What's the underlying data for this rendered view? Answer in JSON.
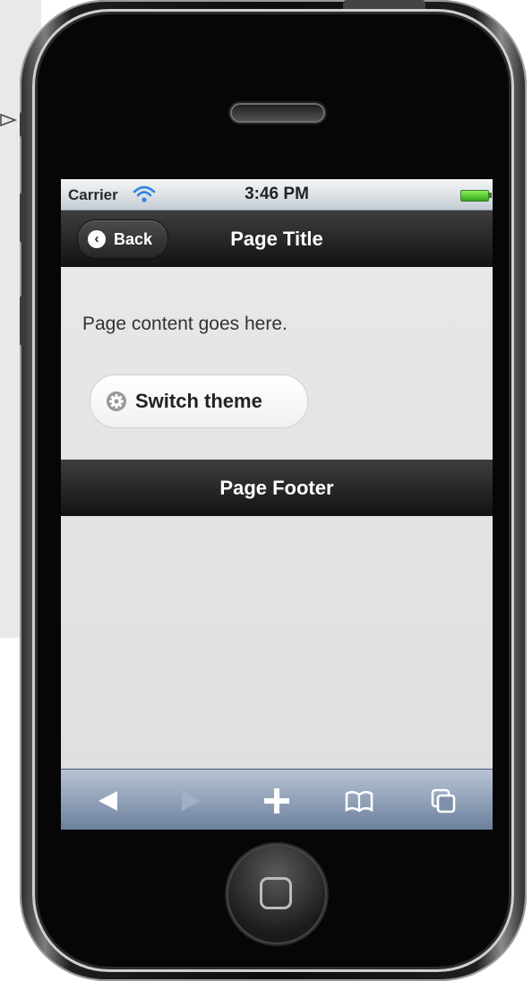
{
  "status_bar": {
    "carrier": "Carrier",
    "time": "3:46 PM"
  },
  "header": {
    "back_label": "Back",
    "title": "Page Title"
  },
  "content": {
    "text": "Page content goes here.",
    "theme_button_label": "Switch theme"
  },
  "footer": {
    "title": "Page Footer"
  },
  "toolbar": {
    "icons": [
      "back-arrow-icon",
      "forward-arrow-icon",
      "plus-icon",
      "bookmarks-icon",
      "pages-icon"
    ]
  },
  "colors": {
    "header_bg": "#1e1e1e",
    "toolbar_bg": "#8a9bb5",
    "battery": "#4cc22a",
    "content_bg": "#e5e5e5"
  }
}
